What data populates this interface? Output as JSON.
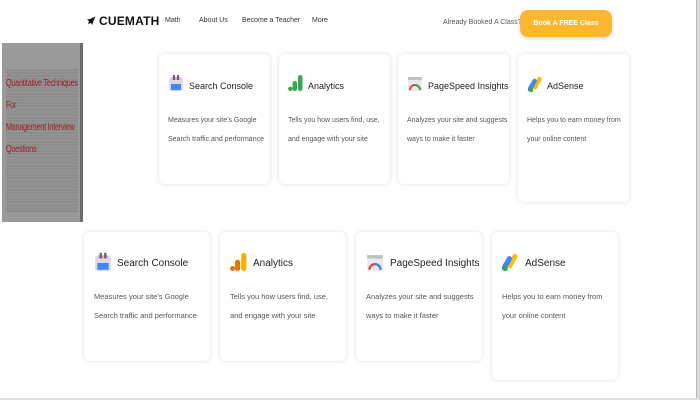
{
  "header": {
    "logo_text": "CUEMATH",
    "nav": [
      "Math",
      "About Us",
      "Become a Teacher",
      "More"
    ],
    "already_booked": "Already Booked A Class?",
    "cta": "Book A FREE Class",
    "cta_color": "#fdb72f"
  },
  "promo": {
    "lines": [
      "Quantitative Techniques For",
      "Management Interview",
      "Questions"
    ],
    "text_color": "#9e1d2a"
  },
  "cards_row1": [
    {
      "title": "Search Console",
      "icon": "search-console-icon",
      "desc": [
        "Measures your site's Google",
        "Search traffic and performance"
      ]
    },
    {
      "title": "Analytics",
      "icon": "analytics-icon",
      "desc": [
        "Tells you how users find, use,",
        "and engage with your site"
      ]
    },
    {
      "title": "PageSpeed Insights",
      "icon": "pagespeed-icon",
      "desc": [
        "Analyzes your site and suggests",
        "ways to make it faster"
      ]
    },
    {
      "title": "AdSense",
      "icon": "adsense-icon",
      "desc": [
        "Helps you to earn money from",
        "your online content"
      ]
    }
  ],
  "cards_row2": [
    {
      "title": "Search Console",
      "icon": "search-console-icon",
      "desc": [
        "Measures your site's Google",
        "Search traffic and performance"
      ]
    },
    {
      "title": "Analytics",
      "icon": "analytics-icon",
      "desc": [
        "Tells you how users find, use,",
        "and engage with your site"
      ]
    },
    {
      "title": "PageSpeed Insights",
      "icon": "pagespeed-icon",
      "desc": [
        "Analyzes your site and suggests",
        "ways to make it faster"
      ]
    },
    {
      "title": "AdSense",
      "icon": "adsense-icon",
      "desc": [
        "Helps you to earn money from",
        "your online content"
      ]
    }
  ]
}
